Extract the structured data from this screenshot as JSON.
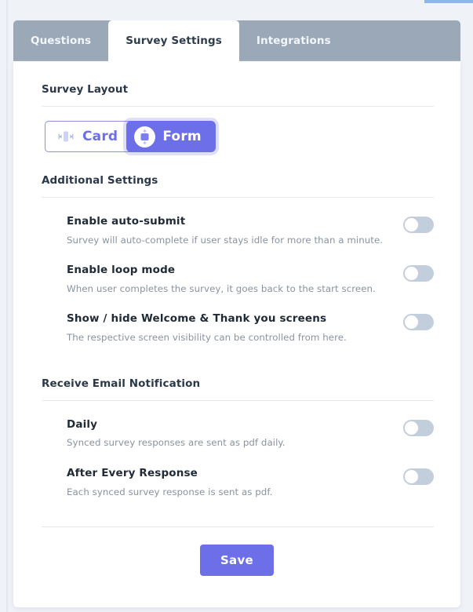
{
  "theme": {
    "accent": "#6c6fe8",
    "tabbar_bg": "#9aa8b8",
    "page_bg": "#eff2f7",
    "toggle_off": "#c3cedd",
    "card_bg": "#ffffff"
  },
  "tabs": [
    {
      "label": "Questions",
      "active": false
    },
    {
      "label": "Survey Settings",
      "active": true
    },
    {
      "label": "Integrations",
      "active": false
    }
  ],
  "survey_layout": {
    "section_title": "Survey Layout",
    "options": [
      {
        "label": "Card",
        "icon": "card-layout-icon",
        "selected": false
      },
      {
        "label": "Form",
        "icon": "form-layout-icon",
        "selected": true
      }
    ]
  },
  "additional_settings": {
    "section_title": "Additional Settings",
    "items": [
      {
        "label": "Enable auto-submit",
        "description": "Survey will auto-complete if user stays idle for more than a minute.",
        "enabled": false
      },
      {
        "label": "Enable loop mode",
        "description": "When user completes the survey, it goes back to the start screen.",
        "enabled": false
      },
      {
        "label": "Show / hide Welcome & Thank you screens",
        "description": "The respective screen visibility can be controlled from here.",
        "enabled": false
      }
    ]
  },
  "email_notification": {
    "section_title": "Receive Email Notification",
    "items": [
      {
        "label": "Daily",
        "description": "Synced survey responses are sent as pdf daily.",
        "enabled": false
      },
      {
        "label": "After Every Response",
        "description": "Each synced survey response is sent as pdf.",
        "enabled": false
      }
    ]
  },
  "footer": {
    "save_label": "Save"
  }
}
